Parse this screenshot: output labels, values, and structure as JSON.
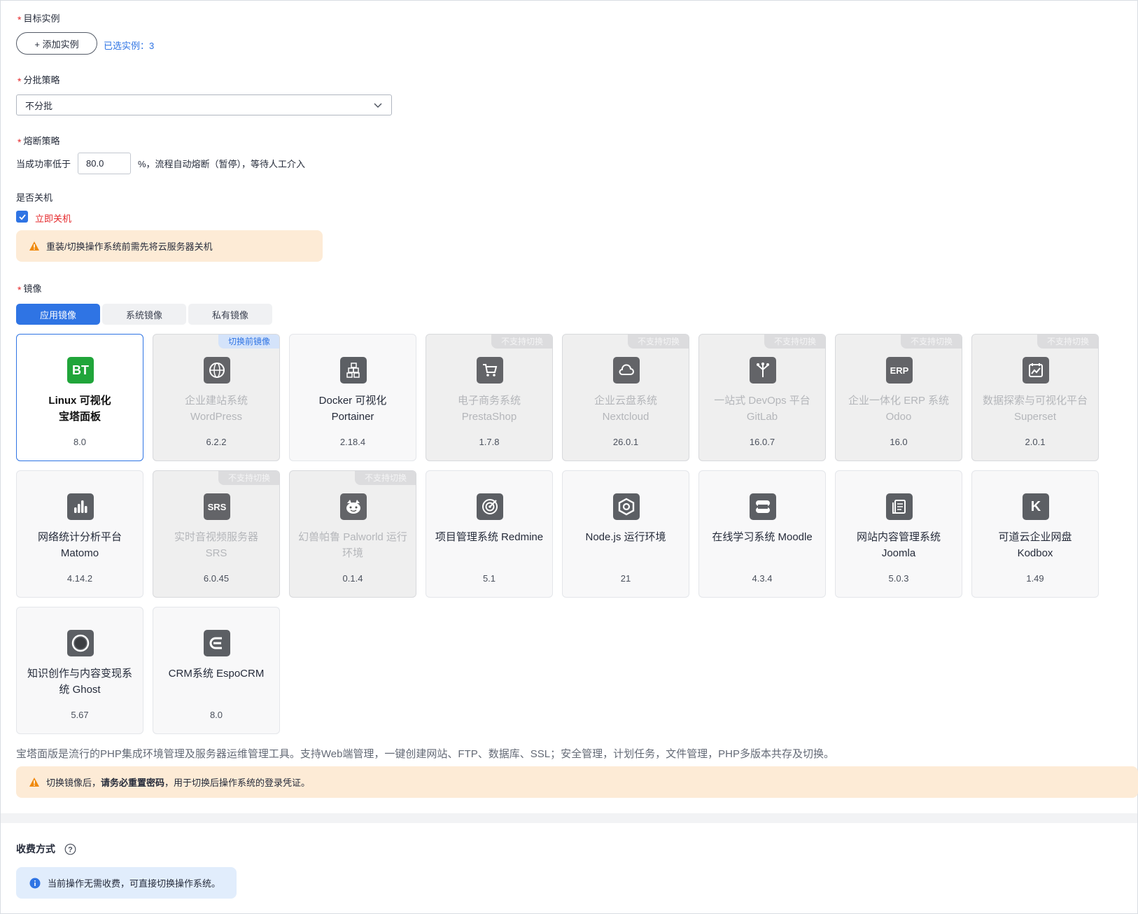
{
  "target": {
    "label": "目标实例",
    "add_button": "+ 添加实例",
    "selected_text": "已选实例：3"
  },
  "batch": {
    "label": "分批策略",
    "value": "不分批"
  },
  "fuse": {
    "label": "熔断策略",
    "prefix": "当成功率低于",
    "value": "80.0",
    "suffix": "%，流程自动熔断（暂停），等待人工介入"
  },
  "shutdown": {
    "label": "是否关机",
    "checkbox_label": "立即关机",
    "checked": true,
    "warning": "重装/切换操作系统前需先将云服务器关机"
  },
  "image": {
    "label": "镜像",
    "tabs": [
      {
        "label": "应用镜像",
        "active": true
      },
      {
        "label": "系统镜像",
        "active": false
      },
      {
        "label": "私有镜像",
        "active": false
      }
    ],
    "cards": [
      {
        "name1": "Linux 可视化",
        "name2": "宝塔面板",
        "version": "8.0",
        "icon": "bt-icon",
        "glyph": "BT",
        "state": "selected",
        "tag": ""
      },
      {
        "name1": "企业建站系统",
        "name2": "WordPress",
        "version": "6.2.2",
        "icon": "globe-icon",
        "glyph": "",
        "state": "disabled",
        "tag": "切换前镜像",
        "tag_style": "blue"
      },
      {
        "name1": "Docker 可视化",
        "name2": "Portainer",
        "version": "2.18.4",
        "icon": "cubes-icon",
        "glyph": "",
        "state": "normal",
        "tag": ""
      },
      {
        "name1": "电子商务系统",
        "name2": "PrestaShop",
        "version": "1.7.8",
        "icon": "cart-icon",
        "glyph": "",
        "state": "disabled",
        "tag": "不支持切换",
        "tag_style": "gray"
      },
      {
        "name1": "企业云盘系统",
        "name2": "Nextcloud",
        "version": "26.0.1",
        "icon": "cloud-icon",
        "glyph": "",
        "state": "disabled",
        "tag": "不支持切换",
        "tag_style": "gray"
      },
      {
        "name1": "一站式 DevOps 平台",
        "name2": "GitLab",
        "version": "16.0.7",
        "icon": "fork-icon",
        "glyph": "",
        "state": "disabled",
        "tag": "不支持切换",
        "tag_style": "gray"
      },
      {
        "name1": "企业一体化 ERP 系统",
        "name2": "Odoo",
        "version": "16.0",
        "icon": "erp-icon",
        "glyph": "ERP",
        "state": "disabled",
        "tag": "不支持切换",
        "tag_style": "gray"
      },
      {
        "name1": "数据探索与可视化平台",
        "name2": "Superset",
        "version": "2.0.1",
        "icon": "chart-calendar-icon",
        "glyph": "",
        "state": "disabled",
        "tag": "不支持切换",
        "tag_style": "gray"
      },
      {
        "name1": "网络统计分析平台",
        "name2": "Matomo",
        "version": "4.14.2",
        "icon": "bar-chart-icon",
        "glyph": "",
        "state": "normal",
        "tag": ""
      },
      {
        "name1": "实时音视频服务器",
        "name2": "SRS",
        "version": "6.0.45",
        "icon": "srs-icon",
        "glyph": "SRS",
        "state": "disabled",
        "tag": "不支持切换",
        "tag_style": "gray"
      },
      {
        "name1": "幻兽帕鲁 Palworld 运行",
        "name2": "环境",
        "version": "0.1.4",
        "icon": "palworld-icon",
        "glyph": "",
        "state": "disabled",
        "tag": "不支持切换",
        "tag_style": "gray"
      },
      {
        "name1": "项目管理系统 Redmine",
        "name2": "",
        "version": "5.1",
        "icon": "target-icon",
        "glyph": "",
        "state": "normal",
        "tag": ""
      },
      {
        "name1": "Node.js 运行环境",
        "name2": "",
        "version": "21",
        "icon": "hexagon-icon",
        "glyph": "",
        "state": "normal",
        "tag": ""
      },
      {
        "name1": "在线学习系统 Moodle",
        "name2": "",
        "version": "4.3.4",
        "icon": "moodle-icon",
        "glyph": "",
        "state": "normal",
        "tag": ""
      },
      {
        "name1": "网站内容管理系统",
        "name2": "Joomla",
        "version": "5.0.3",
        "icon": "document-icon",
        "glyph": "",
        "state": "normal",
        "tag": ""
      },
      {
        "name1": "可道云企业网盘",
        "name2": "Kodbox",
        "version": "1.49",
        "icon": "kodbox-icon",
        "glyph": "K",
        "state": "normal",
        "tag": ""
      },
      {
        "name1": "知识创作与内容变现系",
        "name2": "统 Ghost",
        "version": "5.67",
        "icon": "ghost-icon",
        "glyph": "",
        "state": "normal",
        "tag": ""
      },
      {
        "name1": "CRM系统 EspoCRM",
        "name2": "",
        "version": "8.0",
        "icon": "espocrm-icon",
        "glyph": "",
        "state": "normal",
        "tag": ""
      }
    ],
    "description": "宝塔面版是流行的PHP集成环境管理及服务器运维管理工具。支持Web端管理，一键创建网站、FTP、数据库、SSL；安全管理，计划任务，文件管理，PHP多版本共存及切换。",
    "warning_prefix": "切换镜像后，",
    "warning_bold": "请务必重置密码",
    "warning_suffix": "，用于切换后操作系统的登录凭证。"
  },
  "billing": {
    "title": "收费方式",
    "info": "当前操作无需收费，可直接切换操作系统。"
  }
}
